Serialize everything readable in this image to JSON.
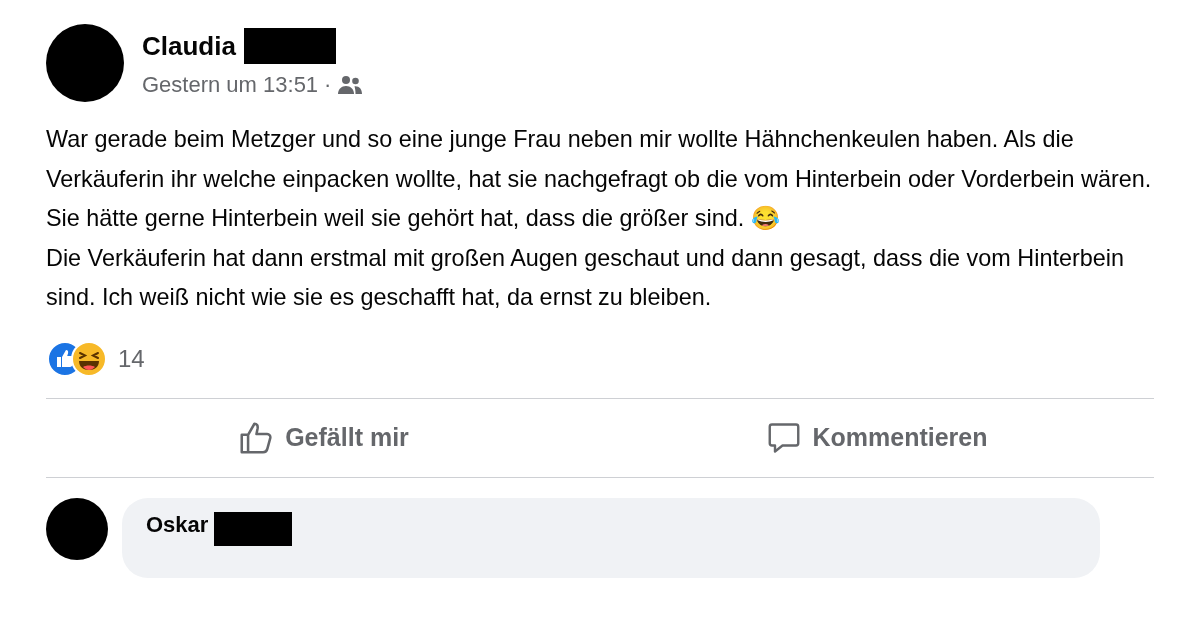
{
  "post": {
    "author": "Claudia",
    "timestamp": "Gestern um 13:51",
    "separator": "·",
    "paragraphs": [
      "War gerade beim Metzger und so eine junge Frau neben mir wollte Hähnchenkeulen haben. Als die Verkäuferin ihr welche einpacken wollte, hat sie nachgefragt ob die vom Hinterbein oder Vorderbein wären. Sie hätte gerne Hinterbein weil sie gehört hat, dass die größer sind. 😂",
      "Die Verkäuferin hat dann erstmal mit großen Augen geschaut und dann gesagt, dass die vom Hinterbein sind. Ich weiß nicht wie sie es geschafft hat, da ernst zu bleiben."
    ],
    "reaction_count": "14",
    "actions": [
      {
        "kind": "like",
        "label": "Gefällt mir"
      },
      {
        "kind": "comment",
        "label": "Kommentieren"
      }
    ]
  },
  "comments": [
    {
      "author": "Oskar"
    }
  ]
}
